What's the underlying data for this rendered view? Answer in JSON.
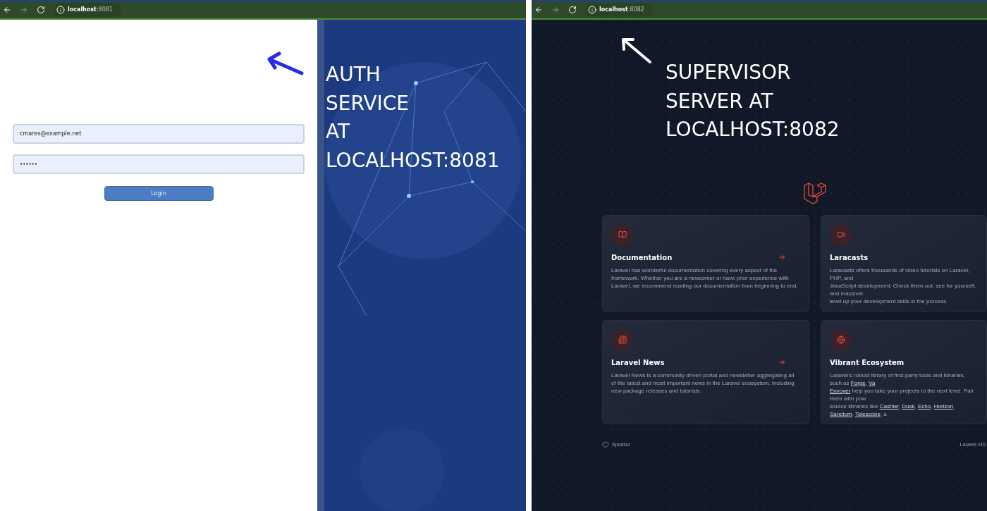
{
  "left_browser": {
    "url_host": "localhost",
    "url_port": ":8081",
    "email_field": {
      "value": "cmares@example.net"
    },
    "password_field": {
      "value": "••••••"
    },
    "login_button": "Login",
    "caption": [
      "AUTH",
      "SERVICE",
      "AT",
      "LOCALHOST:8081"
    ]
  },
  "right_browser": {
    "url_host": "localhost",
    "url_port": ":8082",
    "caption": [
      "SUPERVISOR",
      "SERVER AT",
      "LOCALHOST:8082"
    ],
    "cards": [
      {
        "title": "Documentation",
        "arrow": true,
        "lines": [
          [
            {
              "text": "Laravel has wonderful documentation covering every aspect of the",
              "link": false
            }
          ],
          [
            {
              "text": "framework. Whether you are a newcomer or have prior experience with",
              "link": false
            }
          ],
          [
            {
              "text": "Laravel, we recommend reading our documentation from beginning to end.",
              "link": false
            }
          ]
        ]
      },
      {
        "title": "Laracasts",
        "arrow": false,
        "lines": [
          [
            {
              "text": "Laracasts offers thousands of video tutorials on Laravel, PHP, and",
              "link": false
            }
          ],
          [
            {
              "text": "JavaScript development. Check them out, see for yourself, and massivel",
              "link": false
            }
          ],
          [
            {
              "text": "level up your development skills in the process.",
              "link": false
            }
          ]
        ]
      },
      {
        "title": "Laravel News",
        "arrow": true,
        "lines": [
          [
            {
              "text": "Laravel News is a community driven portal and newsletter aggregating all",
              "link": false
            }
          ],
          [
            {
              "text": "of the latest and most important news in the Laravel ecosystem, including",
              "link": false
            }
          ],
          [
            {
              "text": "new package releases and tutorials.",
              "link": false
            }
          ]
        ]
      },
      {
        "title": "Vibrant Ecosystem",
        "arrow": false,
        "lines": [
          [
            {
              "text": "Laravel's robust library of first-party tools and libraries, such as ",
              "link": false
            },
            {
              "text": "Forge",
              "link": true
            },
            {
              "text": ", ",
              "link": false
            },
            {
              "text": "Va",
              "link": true
            }
          ],
          [
            {
              "text": "Envoyer",
              "link": true
            },
            {
              "text": " help you take your projects to the next level. Pair them with pow",
              "link": false
            }
          ],
          [
            {
              "text": "source libraries like ",
              "link": false
            },
            {
              "text": "Cashier",
              "link": true
            },
            {
              "text": ", ",
              "link": false
            },
            {
              "text": "Dusk",
              "link": true
            },
            {
              "text": ", ",
              "link": false
            },
            {
              "text": "Echo",
              "link": true
            },
            {
              "text": ", ",
              "link": false
            },
            {
              "text": "Horizon",
              "link": true
            },
            {
              "text": ", ",
              "link": false
            },
            {
              "text": "Sanctum",
              "link": true
            },
            {
              "text": ", ",
              "link": false
            },
            {
              "text": "Telescope",
              "link": true
            },
            {
              "text": ", a",
              "link": false
            }
          ]
        ]
      }
    ],
    "sponsor": "Sponsor",
    "version": "Laravel v10"
  }
}
